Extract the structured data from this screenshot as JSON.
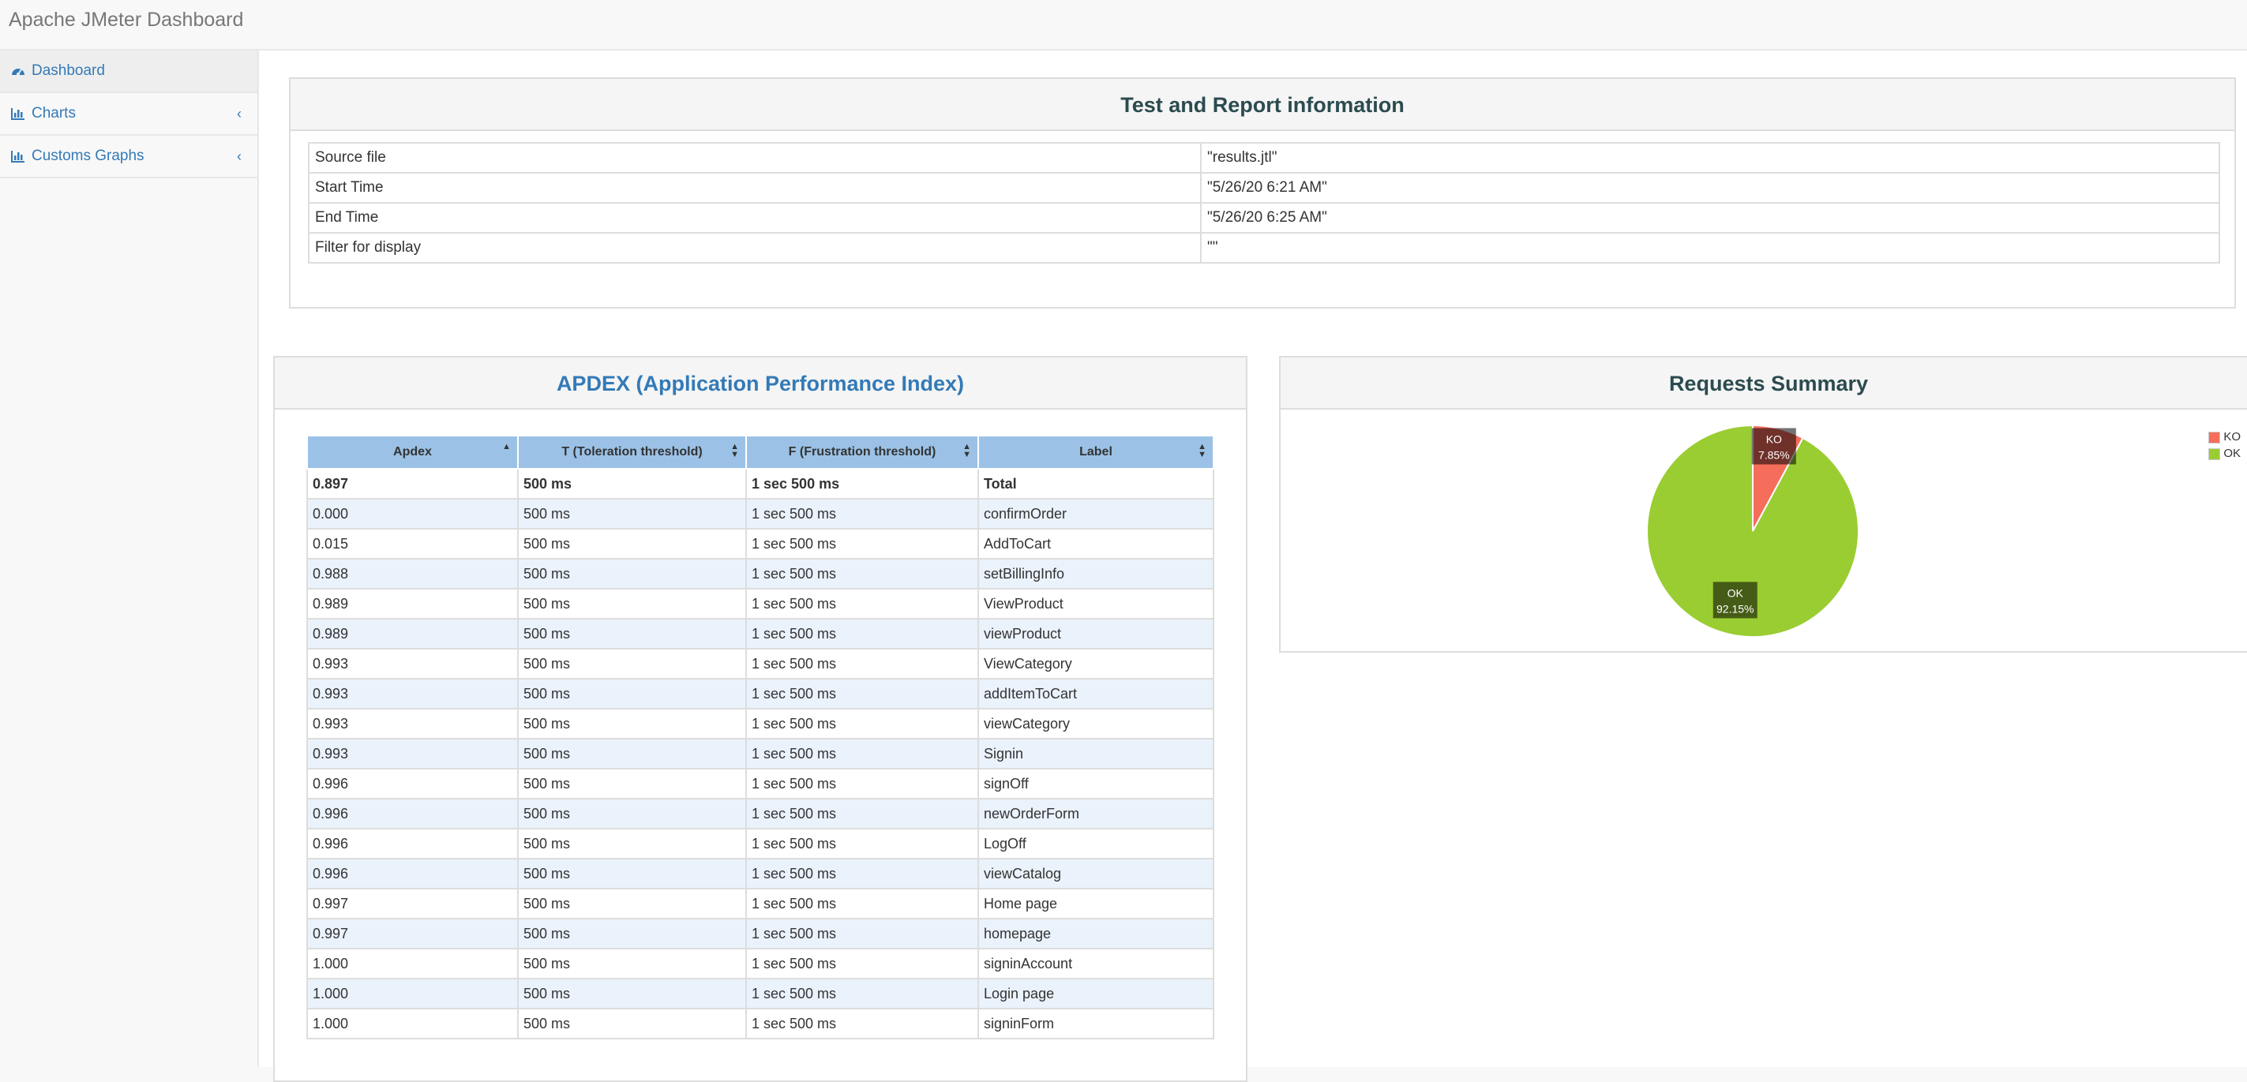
{
  "app": {
    "title": "Apache JMeter Dashboard"
  },
  "sidebar": {
    "items": [
      {
        "label": "Dashboard",
        "icon": "dashboard-icon",
        "active": true
      },
      {
        "label": "Charts",
        "icon": "bar-chart-icon",
        "chevron": "‹"
      },
      {
        "label": "Customs Graphs",
        "icon": "bar-chart-icon",
        "chevron": "‹"
      }
    ]
  },
  "test_info": {
    "title": "Test and Report information",
    "rows": [
      {
        "key": "Source file",
        "value": "\"results.jtl\""
      },
      {
        "key": "Start Time",
        "value": "\"5/26/20 6:21 AM\""
      },
      {
        "key": "End Time",
        "value": "\"5/26/20 6:25 AM\""
      },
      {
        "key": "Filter for display",
        "value": "\"\""
      }
    ]
  },
  "apdex": {
    "title": "APDEX (Application Performance Index)",
    "headers": [
      "Apdex",
      "T (Toleration threshold)",
      "F (Frustration threshold)",
      "Label"
    ],
    "rows": [
      [
        "0.897",
        "500 ms",
        "1 sec 500 ms",
        "Total"
      ],
      [
        "0.000",
        "500 ms",
        "1 sec 500 ms",
        "confirmOrder"
      ],
      [
        "0.015",
        "500 ms",
        "1 sec 500 ms",
        "AddToCart"
      ],
      [
        "0.988",
        "500 ms",
        "1 sec 500 ms",
        "setBillingInfo"
      ],
      [
        "0.989",
        "500 ms",
        "1 sec 500 ms",
        "ViewProduct"
      ],
      [
        "0.989",
        "500 ms",
        "1 sec 500 ms",
        "viewProduct"
      ],
      [
        "0.993",
        "500 ms",
        "1 sec 500 ms",
        "ViewCategory"
      ],
      [
        "0.993",
        "500 ms",
        "1 sec 500 ms",
        "addItemToCart"
      ],
      [
        "0.993",
        "500 ms",
        "1 sec 500 ms",
        "viewCategory"
      ],
      [
        "0.993",
        "500 ms",
        "1 sec 500 ms",
        "Signin"
      ],
      [
        "0.996",
        "500 ms",
        "1 sec 500 ms",
        "signOff"
      ],
      [
        "0.996",
        "500 ms",
        "1 sec 500 ms",
        "newOrderForm"
      ],
      [
        "0.996",
        "500 ms",
        "1 sec 500 ms",
        "LogOff"
      ],
      [
        "0.996",
        "500 ms",
        "1 sec 500 ms",
        "viewCatalog"
      ],
      [
        "0.997",
        "500 ms",
        "1 sec 500 ms",
        "Home page"
      ],
      [
        "0.997",
        "500 ms",
        "1 sec 500 ms",
        "homepage"
      ],
      [
        "1.000",
        "500 ms",
        "1 sec 500 ms",
        "signinAccount"
      ],
      [
        "1.000",
        "500 ms",
        "1 sec 500 ms",
        "Login page"
      ],
      [
        "1.000",
        "500 ms",
        "1 sec 500 ms",
        "signinForm"
      ]
    ]
  },
  "requests_summary": {
    "title": "Requests Summary",
    "colors": {
      "KO": "#f56d5b",
      "OK": "#9acd32"
    }
  },
  "chart_data": {
    "type": "pie",
    "categories": [
      "KO",
      "OK"
    ],
    "values": [
      7.85,
      92.15
    ],
    "slice_labels": [
      "KO\n7.85%",
      "OK\n92.15%"
    ],
    "colors": [
      "#f56d5b",
      "#9acd32"
    ],
    "legend": {
      "position": "top-right",
      "entries": [
        "KO",
        "OK"
      ]
    }
  }
}
